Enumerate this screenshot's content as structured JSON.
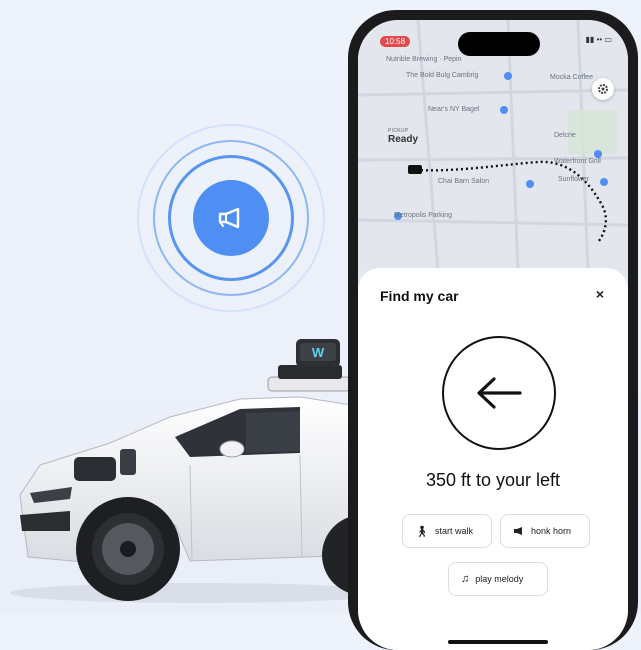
{
  "status_bar": {
    "time": "10:58",
    "icons": "▮▮ •• ▭"
  },
  "map": {
    "labels": [
      "Nutrible Brewing · Pepin",
      "The Bold Bulg Cambrig",
      "Mocka Coffee",
      "Near's NY Bagel",
      "Delcrie",
      "Waterfront Grill",
      "Chai Barn Salon",
      "Sunflower",
      "Metropolis Parking"
    ],
    "pickup_small": "PICKUP",
    "pickup_status": "Ready"
  },
  "find_car": {
    "title": "Find my car",
    "close": "×",
    "distance": "350 ft to your left",
    "actions": {
      "start_walk": "start walk",
      "honk_horn": "honk horn",
      "play_melody": "play melody"
    }
  },
  "colors": {
    "accent": "#4f8ff4",
    "status_red": "#e5484d",
    "background": "#eef2fa"
  },
  "icons": {
    "horn": "horn-icon",
    "arrow": "arrow-left-icon",
    "walk": "walk-icon",
    "honk": "honk-icon",
    "melody": "music-note-icon",
    "settings": "gear-icon"
  }
}
